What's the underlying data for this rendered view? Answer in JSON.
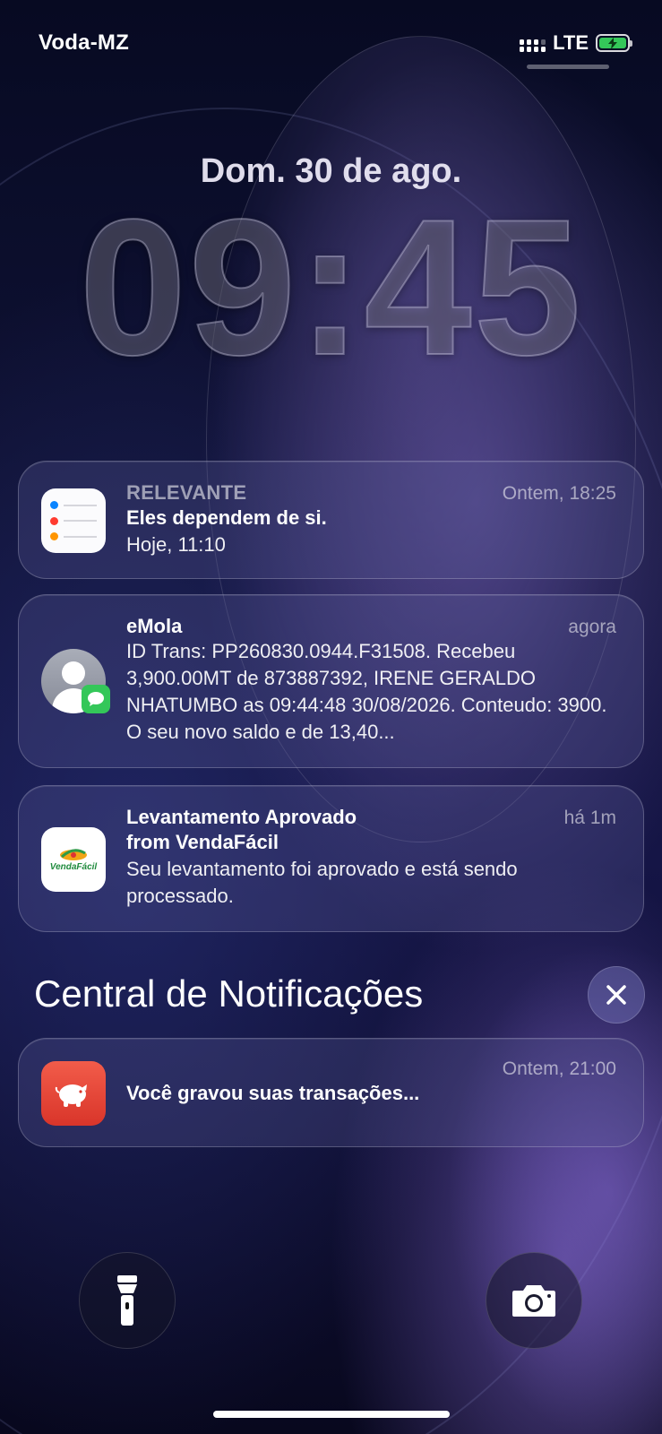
{
  "status_bar": {
    "carrier": "Voda-MZ",
    "network": "LTE",
    "battery_color": "#34c759"
  },
  "lock": {
    "date": "Dom. 30 de ago.",
    "time": "09:45"
  },
  "notifications": [
    {
      "app": "RELEVANTE",
      "icon": "reminders-icon",
      "time": "Ontem, 18:25",
      "title": "Eles dependem de si.",
      "message": "Hoje, 11:10"
    },
    {
      "app": "eMola",
      "icon": "contact-avatar-icon",
      "badge": "messages-icon",
      "time": "agora",
      "message": "ID Trans: PP260830.0944.F31508. Recebeu 3,900.00MT de 873887392, IRENE GERALDO NHATUMBO as 09:44:48 30/08/2026. Conteudo: 3900. O seu novo saldo e de 13,40..."
    },
    {
      "app": "Levantamento Aprovado",
      "subtitle": "from VendaFácil",
      "icon": "vendafacil-logo-icon",
      "logo_text": "VendaFácil",
      "time": "há 1m",
      "message": "Seu levantamento foi aprovado e está sendo processado."
    }
  ],
  "notification_center": {
    "title": "Central de Notificações",
    "close_icon": "close-icon",
    "items": [
      {
        "icon": "piggy-bank-icon",
        "time": "Ontem, 21:00",
        "title": "Você gravou suas transações..."
      }
    ]
  },
  "controls": {
    "flashlight_icon": "flashlight-icon",
    "camera_icon": "camera-icon"
  }
}
